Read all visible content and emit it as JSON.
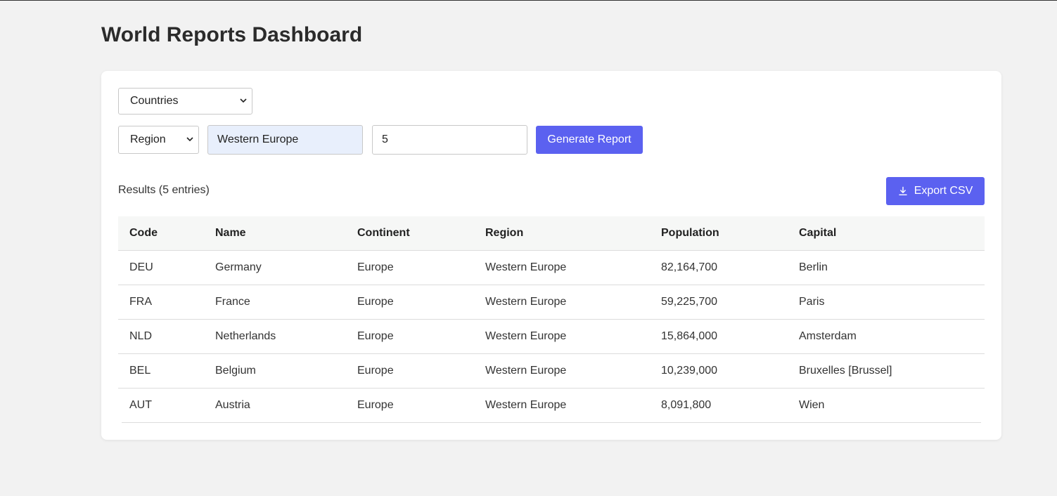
{
  "header": {
    "title": "World Reports Dashboard"
  },
  "controls": {
    "report_type": "Countries",
    "filter_type": "Region",
    "filter_value": "Western Europe",
    "limit": "5",
    "generate_label": "Generate Report"
  },
  "results": {
    "title": "Results (5 entries)",
    "export_label": "Export CSV",
    "columns": [
      "Code",
      "Name",
      "Continent",
      "Region",
      "Population",
      "Capital"
    ],
    "rows": [
      [
        "DEU",
        "Germany",
        "Europe",
        "Western Europe",
        "82,164,700",
        "Berlin"
      ],
      [
        "FRA",
        "France",
        "Europe",
        "Western Europe",
        "59,225,700",
        "Paris"
      ],
      [
        "NLD",
        "Netherlands",
        "Europe",
        "Western Europe",
        "15,864,000",
        "Amsterdam"
      ],
      [
        "BEL",
        "Belgium",
        "Europe",
        "Western Europe",
        "10,239,000",
        "Bruxelles [Brussel]"
      ],
      [
        "AUT",
        "Austria",
        "Europe",
        "Western Europe",
        "8,091,800",
        "Wien"
      ]
    ]
  },
  "colors": {
    "accent": "#5b61f0",
    "page_background": "#f2f2f2",
    "focused_input": "#e8effc"
  },
  "icons": {
    "select_arrow": "chevron-down-icon",
    "export": "download-icon"
  }
}
